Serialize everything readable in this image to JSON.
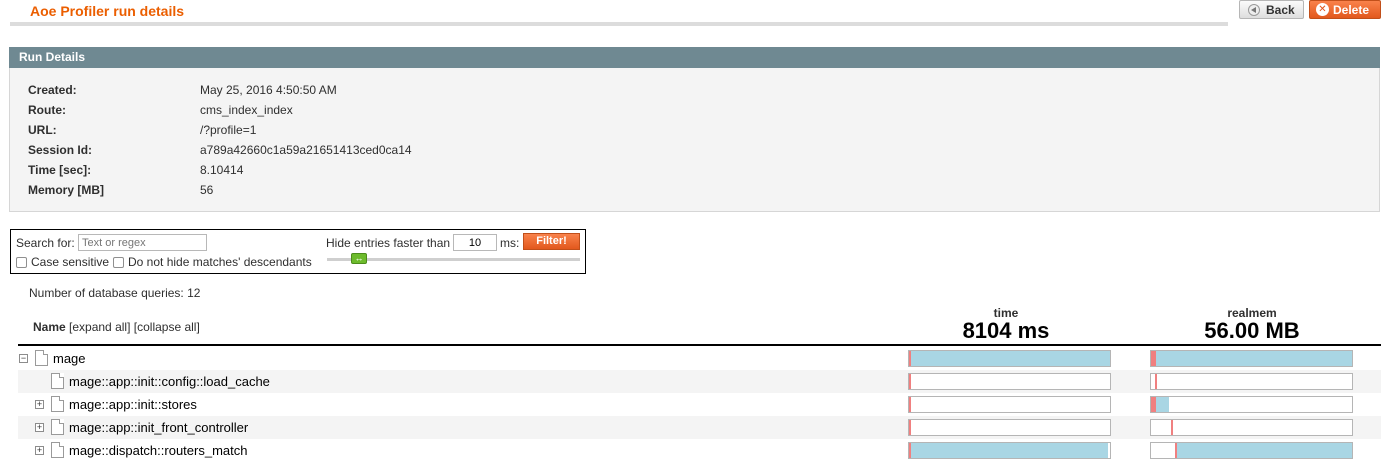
{
  "header": {
    "title": "Aoe Profiler run details",
    "back_label": "Back",
    "delete_label": "Delete"
  },
  "run_details": {
    "heading": "Run Details",
    "fields": [
      {
        "label": "Created:",
        "value": "May 25, 2016 4:50:50 AM"
      },
      {
        "label": "Route:",
        "value": "cms_index_index"
      },
      {
        "label": "URL:",
        "value": "/?profile=1"
      },
      {
        "label": "Session Id:",
        "value": "a789a42660c1a59a21651413ced0ca14"
      },
      {
        "label": "Time [sec]:",
        "value": "8.10414"
      },
      {
        "label": "Memory [MB]",
        "value": "56"
      }
    ]
  },
  "filter": {
    "search_label": "Search for:",
    "search_placeholder": "Text or regex",
    "case_sensitive_label": "Case sensitive",
    "descendants_label": "Do not hide matches' descendants",
    "hide_label": "Hide entries faster than",
    "threshold_value": "10",
    "ms_label": "ms:",
    "filter_button": "Filter!"
  },
  "db_queries_text": "Number of database queries: 12",
  "table": {
    "name_label": "Name",
    "expand_all": "[expand all]",
    "collapse_all": "[collapse all]",
    "time_metric": "time",
    "time_total": "8104 ms",
    "mem_metric": "realmem",
    "mem_total": "56.00 MB",
    "rows": [
      {
        "label": "mage",
        "toggle": "−",
        "time_fraction": 1.0,
        "mem_fraction": 1.0,
        "mem_mark": 0.0
      },
      {
        "label": "mage::app::init::config::load_cache",
        "toggle": "",
        "time_fraction": 0.0,
        "mem_fraction": 0.0,
        "mem_mark": 0.02
      },
      {
        "label": "mage::app::init::stores",
        "toggle": "+",
        "time_fraction": 0.01,
        "mem_fraction": 0.08,
        "mem_mark": 0.0
      },
      {
        "label": "mage::app::init_front_controller",
        "toggle": "+",
        "time_fraction": 0.01,
        "mem_fraction": 0.0,
        "mem_mark": 0.1
      },
      {
        "label": "mage::dispatch::routers_match",
        "toggle": "+",
        "time_fraction": 0.99,
        "mem_fraction": 0.88,
        "mem_mark": 0.12
      }
    ]
  },
  "colors": {
    "title": "#eb5e00",
    "section_header": "#6f8992",
    "bar_fill": "#a9d6e4",
    "bar_mark": "#f08080",
    "accent_button": "#e2581d"
  }
}
